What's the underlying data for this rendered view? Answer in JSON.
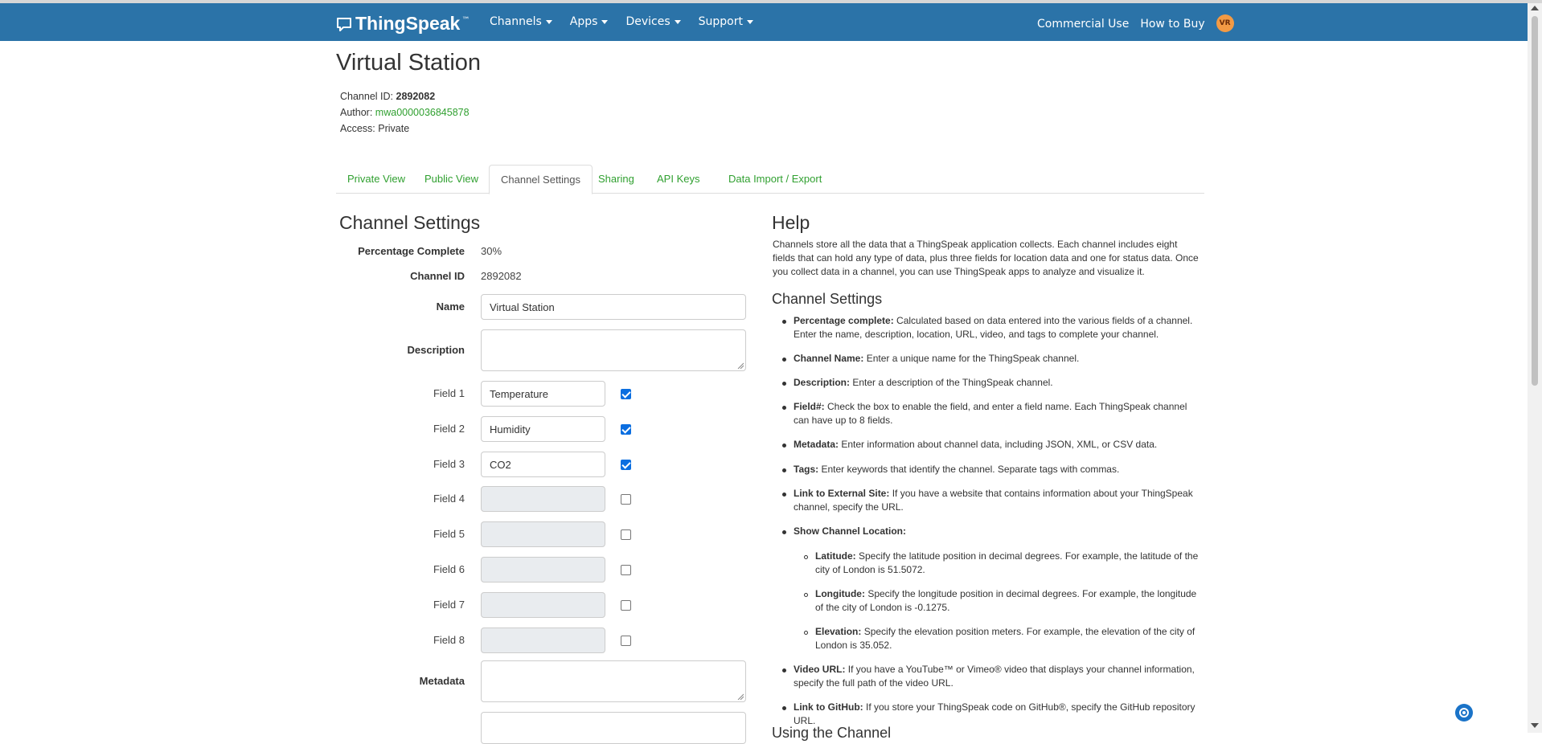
{
  "navbar": {
    "brand": "ThingSpeak",
    "brand_tm": "™",
    "menus": [
      "Channels",
      "Apps",
      "Devices",
      "Support"
    ],
    "right_links": [
      "Commercial Use",
      "How to Buy"
    ],
    "avatar_initials": "VR",
    "bg_color": "#2b73a8"
  },
  "channel": {
    "title": "Virtual Station",
    "id_label": "Channel ID:",
    "id_value": "2892082",
    "author_label": "Author:",
    "author_value": "mwa0000036845878",
    "access_label": "Access:",
    "access_value": "Private"
  },
  "tabs": [
    "Private View",
    "Public View",
    "Channel Settings",
    "Sharing",
    "API Keys",
    "Data Import / Export"
  ],
  "active_tab": "Channel Settings",
  "settings": {
    "heading": "Channel Settings",
    "percentage_label": "Percentage Complete",
    "percentage_value": "30%",
    "channel_id_label": "Channel ID",
    "channel_id_value": "2892082",
    "name_label": "Name",
    "name_value": "Virtual Station",
    "description_label": "Description",
    "description_value": "",
    "fields": [
      {
        "label": "Field 1",
        "value": "Temperature",
        "enabled": true
      },
      {
        "label": "Field 2",
        "value": "Humidity",
        "enabled": true
      },
      {
        "label": "Field 3",
        "value": "CO2",
        "enabled": true
      },
      {
        "label": "Field 4",
        "value": "",
        "enabled": false
      },
      {
        "label": "Field 5",
        "value": "",
        "enabled": false
      },
      {
        "label": "Field 6",
        "value": "",
        "enabled": false
      },
      {
        "label": "Field 7",
        "value": "",
        "enabled": false
      },
      {
        "label": "Field 8",
        "value": "",
        "enabled": false
      }
    ],
    "metadata_label": "Metadata",
    "metadata_value": ""
  },
  "help": {
    "heading": "Help",
    "intro": "Channels store all the data that a ThingSpeak application collects. Each channel includes eight fields that can hold any type of data, plus three fields for location data and one for status data. Once you collect data in a channel, you can use ThingSpeak apps to analyze and visualize it.",
    "subheading": "Channel Settings",
    "items": [
      {
        "term": "Percentage complete:",
        "text": " Calculated based on data entered into the various fields of a channel. Enter the name, description, location, URL, video, and tags to complete your channel."
      },
      {
        "term": "Channel Name:",
        "text": " Enter a unique name for the ThingSpeak channel."
      },
      {
        "term": "Description:",
        "text": " Enter a description of the ThingSpeak channel."
      },
      {
        "term": "Field#:",
        "text": " Check the box to enable the field, and enter a field name. Each ThingSpeak channel can have up to 8 fields."
      },
      {
        "term": "Metadata:",
        "text": " Enter information about channel data, including JSON, XML, or CSV data."
      },
      {
        "term": "Tags:",
        "text": " Enter keywords that identify the channel. Separate tags with commas."
      },
      {
        "term": "Link to External Site:",
        "text": " If you have a website that contains information about your ThingSpeak channel, specify the URL."
      },
      {
        "term": "Show Channel Location:",
        "text": ""
      },
      {
        "term": "Video URL:",
        "text": " If you have a YouTube™ or Vimeo® video that displays your channel information, specify the full path of the video URL."
      },
      {
        "term": "Link to GitHub:",
        "text": " If you store your ThingSpeak code on GitHub®, specify the GitHub repository URL."
      }
    ],
    "location_items": [
      {
        "term": "Latitude:",
        "text": " Specify the latitude position in decimal degrees. For example, the latitude of the city of London is 51.5072."
      },
      {
        "term": "Longitude:",
        "text": " Specify the longitude position in decimal degrees. For example, the longitude of the city of London is -0.1275."
      },
      {
        "term": "Elevation:",
        "text": " Specify the elevation position meters. For example, the elevation of the city of London is 35.052."
      }
    ],
    "next_heading": "Using the Channel"
  }
}
